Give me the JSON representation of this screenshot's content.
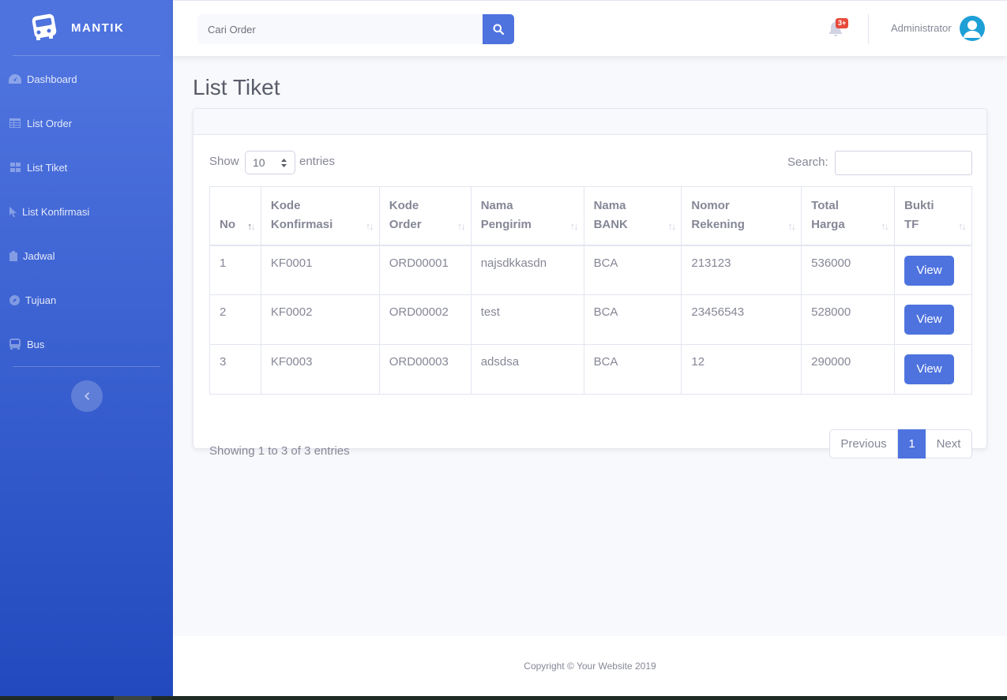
{
  "sidebar": {
    "brand": "MANTIK",
    "brand_icon": "bus-icon",
    "items": [
      {
        "label": "Dashboard",
        "icon": "tachometer-icon"
      },
      {
        "label": "List Order",
        "icon": "table-icon"
      },
      {
        "label": "List Tiket",
        "icon": "th-large-icon"
      },
      {
        "label": "List Konfirmasi",
        "icon": "pointer-icon"
      },
      {
        "label": "Jadwal",
        "icon": "clipboard-icon"
      },
      {
        "label": "Tujuan",
        "icon": "compass-icon"
      },
      {
        "label": "Bus",
        "icon": "bus-icon"
      }
    ],
    "toggle_icon": "chevron-left-icon"
  },
  "topbar": {
    "search_placeholder": "Cari Order",
    "search_icon": "search-icon",
    "alerts_badge": "3+",
    "user_name": "Administrator",
    "avatar_icon": "user-icon"
  },
  "page": {
    "title": "List Tiket"
  },
  "table_controls": {
    "show_label": "Show",
    "page_length": "10",
    "entries_label": "entries",
    "search_label": "Search:"
  },
  "table": {
    "columns": [
      {
        "line1": "No",
        "line2": ""
      },
      {
        "line1": "Kode",
        "line2": "Konfirmasi"
      },
      {
        "line1": "Kode",
        "line2": "Order"
      },
      {
        "line1": "Nama",
        "line2": "Pengirim"
      },
      {
        "line1": "Nama",
        "line2": "BANK"
      },
      {
        "line1": "Nomor",
        "line2": "Rekening"
      },
      {
        "line1": "Total",
        "line2": "Harga"
      },
      {
        "line1": "Bukti",
        "line2": "TF"
      }
    ],
    "rows": [
      {
        "no": "1",
        "kode_konfirmasi": "KF0001",
        "kode_order": "ORD00001",
        "nama_pengirim": "najsdkkasdn",
        "nama_bank": "BCA",
        "nomor_rekening": "213123",
        "total_harga": "536000",
        "bukti": "View"
      },
      {
        "no": "2",
        "kode_konfirmasi": "KF0002",
        "kode_order": "ORD00002",
        "nama_pengirim": "test",
        "nama_bank": "BCA",
        "nomor_rekening": "23456543",
        "total_harga": "528000",
        "bukti": "View"
      },
      {
        "no": "3",
        "kode_konfirmasi": "KF0003",
        "kode_order": "ORD00003",
        "nama_pengirim": "adsdsa",
        "nama_bank": "BCA",
        "nomor_rekening": "12",
        "total_harga": "290000",
        "bukti": "View"
      }
    ],
    "info": "Showing 1 to 3 of 3 entries"
  },
  "pagination": {
    "previous": "Previous",
    "current": "1",
    "next": "Next"
  },
  "footer": {
    "copyright": "Copyright © Your Website 2019"
  },
  "colors": {
    "primary": "#4e73df",
    "sidebar_dark": "#224abe",
    "danger": "#e74a3b",
    "text_muted": "#858796"
  }
}
